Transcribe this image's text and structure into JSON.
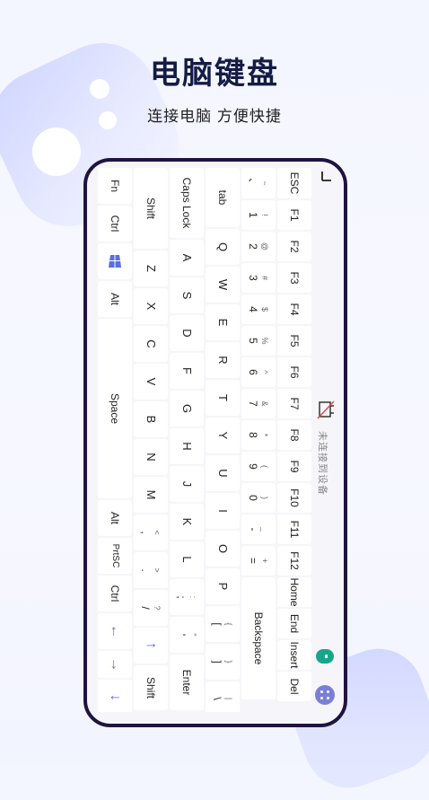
{
  "header": {
    "title": "电脑键盘",
    "subtitle": "连接电脑 方便快捷"
  },
  "status": {
    "connection": "未连接到设备",
    "connected": false
  },
  "colors": {
    "accent": "#5a6ee0",
    "toggle": "#18a58a",
    "frame": "#1f1440"
  },
  "keyboard": {
    "row_fn": [
      "ESC",
      "F1",
      "F2",
      "F3",
      "F4",
      "F5",
      "F6",
      "F7",
      "F8",
      "F9",
      "F10",
      "F11",
      "F12",
      "Home",
      "End",
      "Insert",
      "Del"
    ],
    "row_num": [
      {
        "top": "~",
        "bottom": "、"
      },
      {
        "top": "!",
        "bottom": "1"
      },
      {
        "top": "@",
        "bottom": "2"
      },
      {
        "top": "#",
        "bottom": "3"
      },
      {
        "top": "$",
        "bottom": "4"
      },
      {
        "top": "%",
        "bottom": "5"
      },
      {
        "top": "^",
        "bottom": "6"
      },
      {
        "top": "&",
        "bottom": "7"
      },
      {
        "top": "*",
        "bottom": "8"
      },
      {
        "top": "(",
        "bottom": "9"
      },
      {
        "top": ")",
        "bottom": "0"
      },
      {
        "top": "_",
        "bottom": "-"
      },
      {
        "top": "+",
        "bottom": "="
      }
    ],
    "backspace": "Backspace",
    "tab": "tab",
    "row_q": [
      "Q",
      "W",
      "E",
      "R",
      "T",
      "Y",
      "U",
      "I",
      "O",
      "P"
    ],
    "row_q_sym": [
      {
        "top": "{",
        "bottom": "["
      },
      {
        "top": "}",
        "bottom": "]"
      },
      {
        "top": "|",
        "bottom": "\\"
      }
    ],
    "caps": "Caps Lock",
    "row_a": [
      "A",
      "S",
      "D",
      "F",
      "G",
      "H",
      "J",
      "K",
      "L"
    ],
    "row_a_sym": [
      {
        "top": ":",
        "bottom": ";"
      },
      {
        "top": "\"",
        "bottom": "'"
      }
    ],
    "enter": "Enter",
    "shift": "Shift",
    "row_z": [
      "Z",
      "X",
      "C",
      "V",
      "B",
      "N",
      "M"
    ],
    "row_z_sym": [
      {
        "top": "<",
        "bottom": ","
      },
      {
        "top": ">",
        "bottom": "."
      },
      {
        "top": "?",
        "bottom": "/"
      }
    ],
    "arrows": {
      "up": "↑",
      "left": "←",
      "right": "→",
      "down": "↓"
    },
    "fn": "Fn",
    "ctrl": "Ctrl",
    "win_icon": "windows-icon",
    "alt": "Alt",
    "space": "Space",
    "prtsc": "PrtSC"
  }
}
